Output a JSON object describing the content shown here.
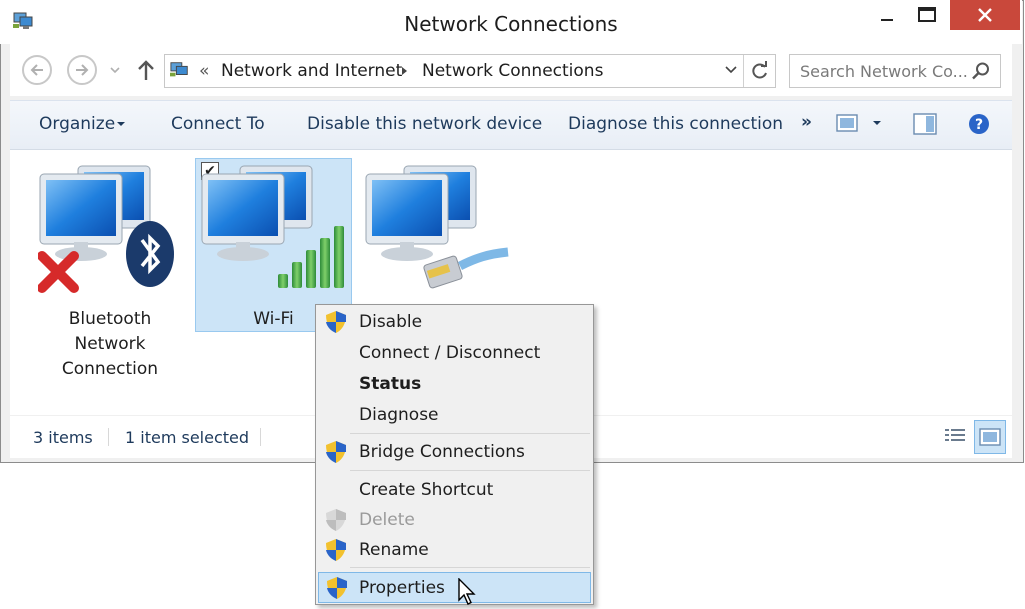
{
  "window": {
    "title": "Network Connections"
  },
  "addressbar": {
    "overflow": "«",
    "crumbs": [
      "Network and Internet",
      "Network Connections"
    ]
  },
  "search": {
    "placeholder": "Search Network Co..."
  },
  "commandbar": {
    "organize": "Organize",
    "connect_to": "Connect To",
    "disable": "Disable this network device",
    "diagnose": "Diagnose this connection",
    "more": "»"
  },
  "items": [
    {
      "label_lines": [
        "Bluetooth",
        "Network",
        "Connection"
      ],
      "icon": "bluetooth-network-icon",
      "status": "disconnected"
    },
    {
      "label_lines": [
        "Wi-Fi"
      ],
      "icon": "wifi-network-icon",
      "selected": true
    },
    {
      "label_lines": [],
      "icon": "ethernet-network-icon"
    }
  ],
  "statusbar": {
    "count": "3 items",
    "selected": "1 item selected"
  },
  "context_menu": {
    "items": [
      {
        "label": "Disable",
        "shield": true
      },
      {
        "label": "Connect / Disconnect",
        "shield": false
      },
      {
        "label": "Status",
        "shield": false,
        "bold": true
      },
      {
        "label": "Diagnose",
        "shield": false
      },
      {
        "label": "Bridge Connections",
        "shield": true
      },
      {
        "label": "Create Shortcut",
        "shield": false
      },
      {
        "label": "Delete",
        "shield": true,
        "disabled": true
      },
      {
        "label": "Rename",
        "shield": true
      },
      {
        "label": "Properties",
        "shield": true,
        "highlighted": true
      }
    ]
  },
  "colors": {
    "accent": "#1e3a5c",
    "selection": "#cce4f7",
    "close": "#c9483b"
  }
}
